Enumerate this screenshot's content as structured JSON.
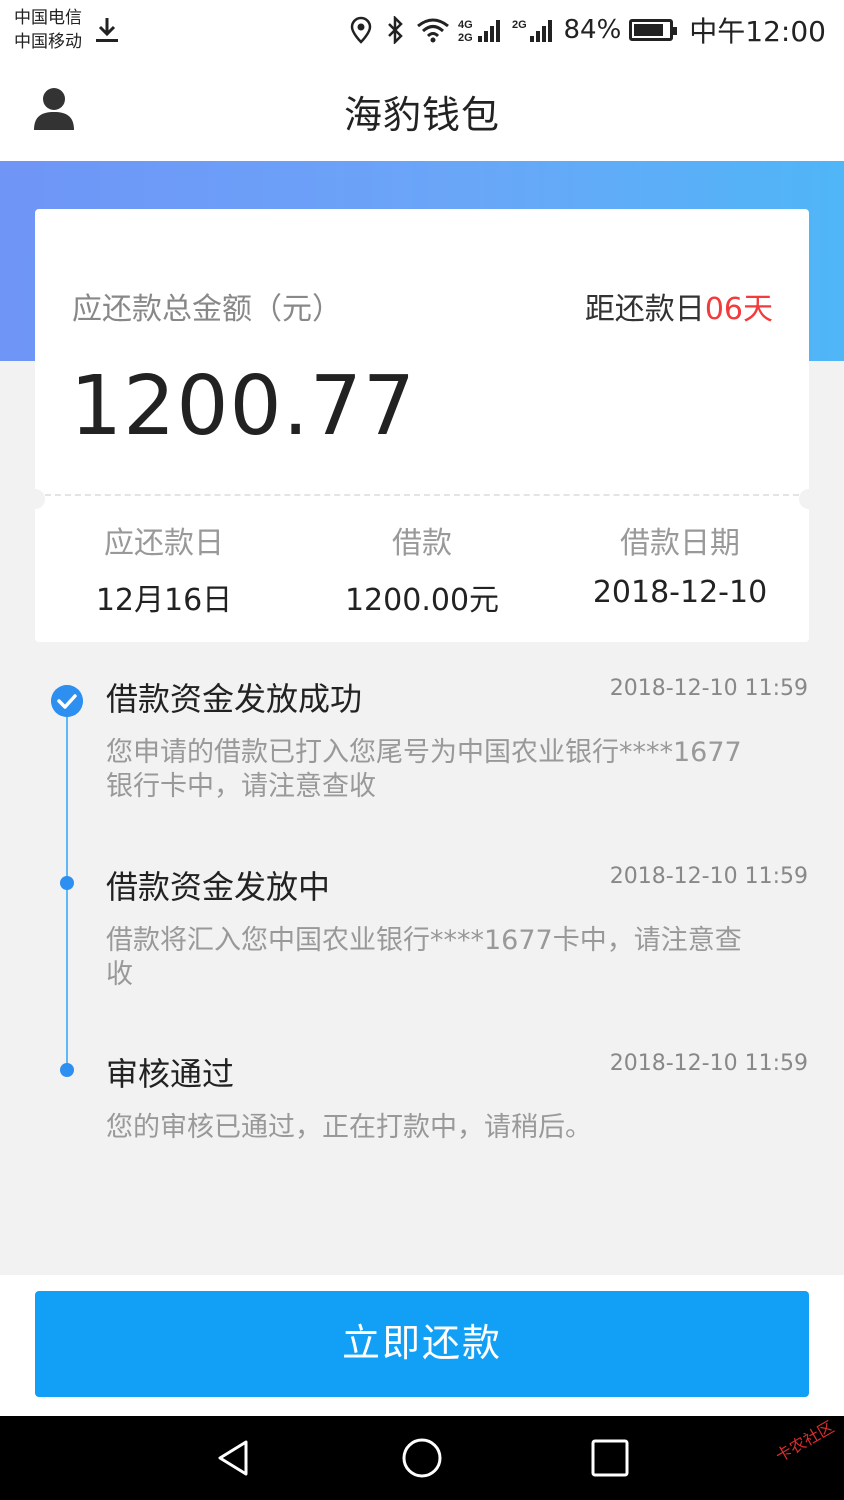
{
  "status_bar": {
    "carrier_1": "中国电信",
    "carrier_2": "中国移动",
    "battery_percent": "84%",
    "battery_level": 0.84,
    "time": "中午12:00",
    "icons": [
      "download-icon",
      "location-icon",
      "bluetooth-icon",
      "wifi-icon",
      "signal-4g-icon",
      "signal-2g-icon",
      "battery-icon"
    ]
  },
  "header": {
    "title": "海豹钱包",
    "profile_icon": "user-icon"
  },
  "colors": {
    "accent_blue": "#12a0f7",
    "timeline_blue": "#2d8ff0",
    "due_red": "#f23b3b",
    "gradient_start": "#6f95f7",
    "gradient_end": "#4fb6f7"
  },
  "summary": {
    "total_label": "应还款总金额（元）",
    "due_prefix": "距还款日",
    "due_days": "06天",
    "amount": "1200.77",
    "columns": [
      {
        "label": "应还款日",
        "value": "12月16日"
      },
      {
        "label": "借款",
        "value": "1200.00元"
      },
      {
        "label": "借款日期",
        "value": "2018-12-10"
      }
    ]
  },
  "timeline": [
    {
      "title": "借款资金发放成功",
      "time": "2018-12-10 11:59",
      "desc": "您申请的借款已打入您尾号为中国农业银行****1677银行卡中，请注意查收",
      "status": "done"
    },
    {
      "title": "借款资金发放中",
      "time": "2018-12-10 11:59",
      "desc": "借款将汇入您中国农业银行****1677卡中，请注意查收",
      "status": "step"
    },
    {
      "title": "审核通过",
      "time": "2018-12-10 11:59",
      "desc": "您的审核已通过，正在打款中，请稍后。",
      "status": "step"
    }
  ],
  "actions": {
    "repay_label": "立即还款"
  },
  "watermark": "卡农社区",
  "navbar": {
    "icons": [
      "back-icon",
      "home-icon",
      "recents-icon"
    ]
  }
}
